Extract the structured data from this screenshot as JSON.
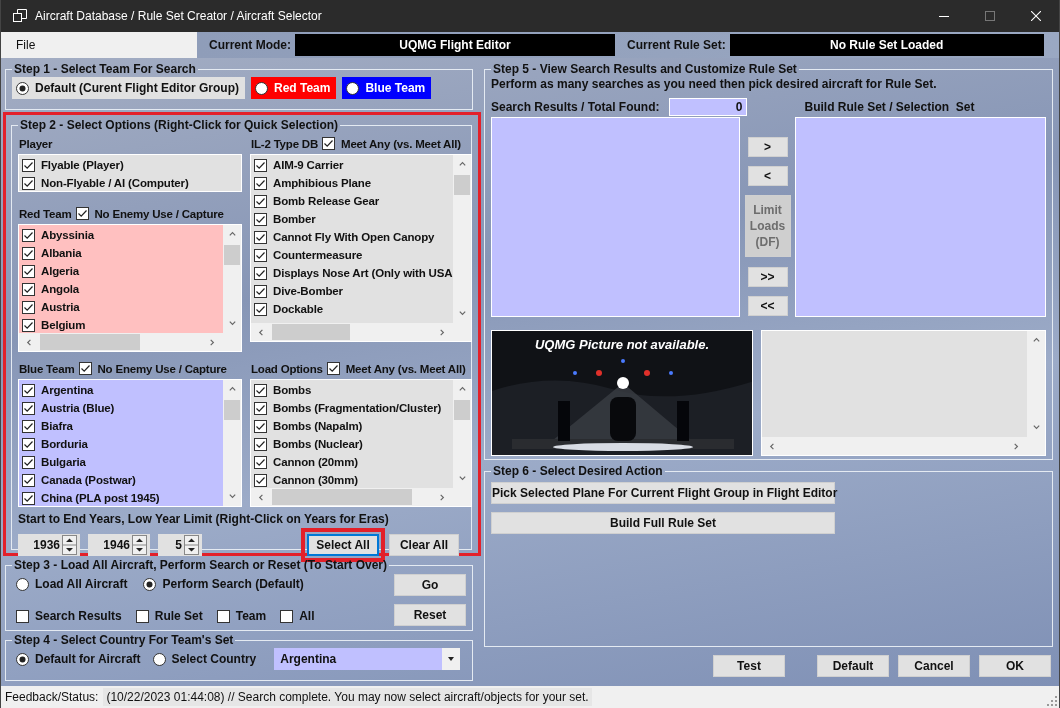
{
  "window": {
    "title": "Aircraft Database / Rule Set Creator / Aircraft Selector"
  },
  "menu": [
    {
      "label": "File"
    }
  ],
  "current_mode": {
    "label": "Current Mode:",
    "value": "UQMG Flight Editor"
  },
  "current_rule_set": {
    "label": "Current Rule Set:",
    "value": "No Rule Set Loaded"
  },
  "step1": {
    "title": "Step 1 - Select Team For Search",
    "options": [
      {
        "label": "Default (Curent Flight Editor Group)",
        "selected": true,
        "color": "#e1e1e1"
      },
      {
        "label": "Red Team",
        "selected": false,
        "color": "#ff0000"
      },
      {
        "label": "Blue Team",
        "selected": false,
        "color": "#0000ff"
      }
    ]
  },
  "step2": {
    "title": "Step 2 - Select Options (Right-Click for Quick Selection)",
    "highlighted": true,
    "player": {
      "title": "Player",
      "color": "#e1e1e1",
      "items": [
        {
          "label": "Flyable (Player)",
          "checked": true
        },
        {
          "label": "Non-Flyable / AI (Computer)",
          "checked": true
        }
      ]
    },
    "type_db": {
      "title": "IL-2 Type DB",
      "color": "#e1e1e1",
      "option": {
        "label": "Meet Any (vs. Meet All)",
        "checked": true
      },
      "items": [
        {
          "label": "AIM-9 Carrier",
          "checked": true
        },
        {
          "label": "Amphibious Plane",
          "checked": true
        },
        {
          "label": "Bomb Release Gear",
          "checked": true
        },
        {
          "label": "Bomber",
          "checked": true
        },
        {
          "label": "Cannot Fly With Open Canopy",
          "checked": true
        },
        {
          "label": "Countermeasure",
          "checked": true
        },
        {
          "label": "Displays Nose Art (Only with USA",
          "checked": true
        },
        {
          "label": "Dive-Bomber",
          "checked": true
        },
        {
          "label": "Dockable",
          "checked": true
        }
      ]
    },
    "red_team": {
      "title": "Red Team",
      "color": "#ffc0c0",
      "option": {
        "label": "No Enemy Use / Capture",
        "checked": true
      },
      "items": [
        {
          "label": "Abyssinia",
          "checked": true
        },
        {
          "label": "Albania",
          "checked": true
        },
        {
          "label": "Algeria",
          "checked": true
        },
        {
          "label": "Angola",
          "checked": true
        },
        {
          "label": "Austria",
          "checked": true
        },
        {
          "label": "Belgium",
          "checked": true
        }
      ]
    },
    "blue_team": {
      "title": "Blue Team",
      "color": "#c0c0ff",
      "option": {
        "label": "No Enemy Use / Capture",
        "checked": true
      },
      "items": [
        {
          "label": "Argentina",
          "checked": true
        },
        {
          "label": "Austria (Blue)",
          "checked": true
        },
        {
          "label": "Biafra",
          "checked": true
        },
        {
          "label": "Borduria",
          "checked": true
        },
        {
          "label": "Bulgaria",
          "checked": true
        },
        {
          "label": "Canada (Postwar)",
          "checked": true
        },
        {
          "label": "China (PLA post 1945)",
          "checked": true
        }
      ]
    },
    "load_options": {
      "title": "Load Options",
      "color": "#e1e1e1",
      "option": {
        "label": "Meet Any (vs. Meet All)",
        "checked": true
      },
      "items": [
        {
          "label": "Bombs",
          "checked": true
        },
        {
          "label": "Bombs (Fragmentation/Cluster)",
          "checked": true
        },
        {
          "label": "Bombs (Napalm)",
          "checked": true
        },
        {
          "label": "Bombs (Nuclear)",
          "checked": true
        },
        {
          "label": "Cannon (20mm)",
          "checked": true
        },
        {
          "label": "Cannon (30mm)",
          "checked": true
        }
      ]
    },
    "years_label": "Start to End Years, Low Year Limit (Right-Click on Years for Eras)",
    "spinners": [
      "1936",
      "1946",
      "5"
    ],
    "buttons": [
      {
        "label": "Select All",
        "highlighted": true
      },
      {
        "label": "Clear All",
        "highlighted": false
      }
    ]
  },
  "step3": {
    "title": "Step 3 - Load All Aircraft, Perform Search or Reset (To Start Over)",
    "options": [
      {
        "label": "Load All Aircraft",
        "selected": false
      },
      {
        "label": "Perform Search (Default)",
        "selected": true
      }
    ],
    "checks": [
      {
        "label": "Search Results",
        "checked": false
      },
      {
        "label": "Rule Set",
        "checked": false
      },
      {
        "label": "Team",
        "checked": false
      },
      {
        "label": "All",
        "checked": false
      }
    ],
    "buttons": [
      "Go",
      "Reset"
    ]
  },
  "step4": {
    "title": "Step 4 - Select Country For Team's Set",
    "options": [
      {
        "label": "Default for Aircraft",
        "selected": true
      },
      {
        "label": "Select Country",
        "selected": false
      }
    ],
    "country": "Argentina"
  },
  "step5": {
    "title": "Step 5 - View Search Results and Customize Rule Set",
    "instructions": "Perform as many searches as you need then pick desired aircraft for Rule Set.",
    "results_label": "Search Results / Total Found:",
    "total": "0",
    "build_label": "Build Rule Set / Selection  Set",
    "move_buttons": [
      {
        "label": ">",
        "disabled": false
      },
      {
        "label": "<",
        "disabled": false
      },
      {
        "label": "Limit Loads (DF)",
        "disabled": true
      },
      {
        "label": ">>",
        "disabled": false
      },
      {
        "label": "<<",
        "disabled": false
      }
    ],
    "picture_caption": "UQMG Picture not available."
  },
  "step6": {
    "title": "Step 6 - Select Desired Action",
    "buttons": [
      "Pick Selected Plane For Current Flight Group in Flight Editor",
      "Build Full Rule Set"
    ]
  },
  "dialog_buttons": [
    "Test",
    "Default",
    "Cancel",
    "OK"
  ],
  "status": {
    "label": "Feedback/Status:",
    "message": "(10/22/2023 01:44:08) // Search complete. You may now select aircraft/objects for your set."
  }
}
